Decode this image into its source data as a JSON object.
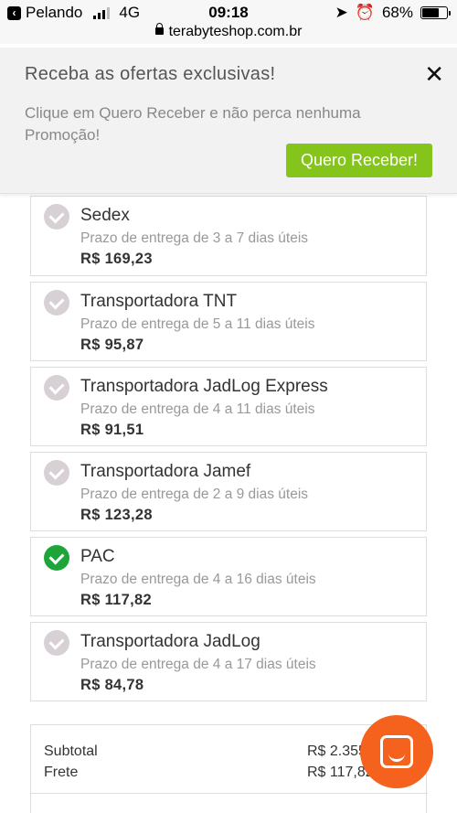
{
  "status_bar": {
    "back_label": "Pelando",
    "network": "4G",
    "time": "09:18",
    "battery": "68%",
    "battery_level": 0.68
  },
  "url_bar": {
    "domain": "terabyteshop.com.br"
  },
  "promo": {
    "title": "Receba as ofertas exclusivas!",
    "close_glyph": "✕",
    "text": "Clique em Quero Receber e não perca nenhuma Promoção!",
    "button_label": "Quero Receber!",
    "button_color": "#84c41b"
  },
  "shipping_options": [
    {
      "name": "Sedex",
      "time": "Prazo de entrega de 3 a 7 dias úteis",
      "price": "R$ 169,23",
      "selected": false
    },
    {
      "name": "Transportadora TNT",
      "time": "Prazo de entrega de 5 a 11 dias úteis",
      "price": "R$ 95,87",
      "selected": false
    },
    {
      "name": "Transportadora JadLog Express",
      "time": "Prazo de entrega de 4 a 11 dias úteis",
      "price": "R$ 91,51",
      "selected": false
    },
    {
      "name": "Transportadora Jamef",
      "time": "Prazo de entrega de 2 a 9 dias úteis",
      "price": "R$ 123,28",
      "selected": false
    },
    {
      "name": "PAC",
      "time": "Prazo de entrega de 4 a 16 dias úteis",
      "price": "R$ 117,82",
      "selected": true
    },
    {
      "name": "Transportadora JadLog",
      "time": "Prazo de entrega de 4 a 17 dias úteis",
      "price": "R$ 84,78",
      "selected": false
    }
  ],
  "summary": {
    "subtotal_label": "Subtotal",
    "subtotal_value": "R$ 2.355",
    "frete_label": "Frete",
    "frete_value": "R$ 117,82"
  },
  "colors": {
    "selected": "#1ea53a",
    "chat": "#f5621d"
  },
  "chat_icon": "chat-smile-icon"
}
